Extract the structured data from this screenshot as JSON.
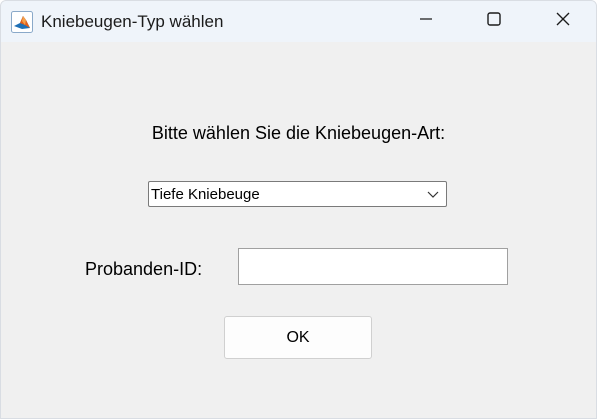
{
  "window": {
    "title": "Kniebeugen-Typ wählen",
    "app_icon": "matlab-logo-icon",
    "controls": {
      "minimize_icon": "minimize-icon",
      "maximize_icon": "maximize-icon",
      "close_icon": "close-icon"
    }
  },
  "dialog": {
    "prompt": "Bitte wählen Sie die Kniebeugen-Art:",
    "squat_type_select": {
      "selected": "Tiefe Kniebeuge",
      "icon": "chevron-down-icon"
    },
    "subject_id": {
      "label": "Probanden-ID:",
      "value": "",
      "placeholder": ""
    },
    "ok_label": "OK"
  },
  "colors": {
    "titlebar": "#eff4fa",
    "background": "#f0f0f0",
    "matlab_orange": "#e2601b",
    "matlab_blue": "#1e6fb5"
  }
}
